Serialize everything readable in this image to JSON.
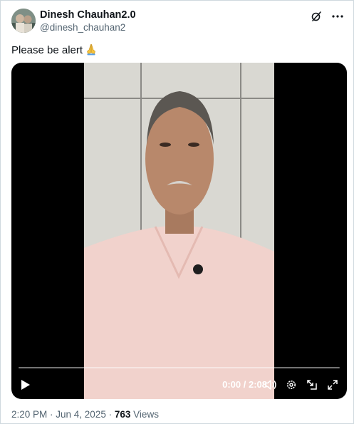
{
  "author": {
    "display_name": "Dinesh Chauhan2.0",
    "handle": "@dinesh_chauhan2"
  },
  "header_icons": [
    "grok-icon",
    "more-icon"
  ],
  "tweet": {
    "text": "Please be alert",
    "emoji": "folded-hands"
  },
  "video": {
    "time_display": "0:00 / 2:08",
    "progress": 0.0,
    "controls": [
      "play-icon",
      "volume-icon",
      "settings-icon",
      "pip-icon",
      "fullscreen-icon"
    ]
  },
  "meta": {
    "timestamp": "2:20 PM · Jun 4, 2025",
    "separator": "·",
    "views_count": "763",
    "views_label": "Views"
  },
  "colors": {
    "accent": "#1d9bf0",
    "text_primary": "#0f1419",
    "text_secondary": "#536471",
    "border": "#cfd9de"
  }
}
